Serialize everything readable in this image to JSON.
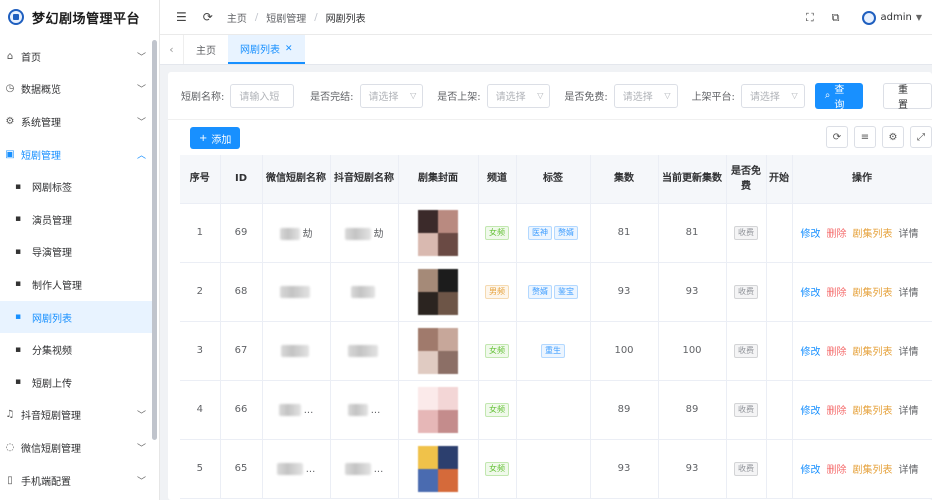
{
  "brand": {
    "title": "梦幻剧场管理平台"
  },
  "sidebar": {
    "items": [
      {
        "label": "首页",
        "icon": "home-icon"
      },
      {
        "label": "数据概览",
        "icon": "dashboard-icon"
      },
      {
        "label": "系统管理",
        "icon": "gear-icon"
      },
      {
        "label": "短剧管理",
        "icon": "video-icon",
        "open": true
      },
      {
        "label": "网剧标签",
        "sub": true
      },
      {
        "label": "演员管理",
        "sub": true
      },
      {
        "label": "导演管理",
        "sub": true
      },
      {
        "label": "制作人管理",
        "sub": true
      },
      {
        "label": "网剧列表",
        "sub": true,
        "active": true
      },
      {
        "label": "分集视频",
        "sub": true
      },
      {
        "label": "短剧上传",
        "sub": true
      },
      {
        "label": "抖音短剧管理",
        "icon": "music-icon"
      },
      {
        "label": "微信短剧管理",
        "icon": "chat-icon"
      },
      {
        "label": "手机端配置",
        "icon": "phone-icon"
      }
    ]
  },
  "header": {
    "breadcrumb": [
      "主页",
      "短剧管理",
      "网剧列表"
    ],
    "user": "admin"
  },
  "tabs": [
    {
      "label": "主页"
    },
    {
      "label": "网剧列表",
      "active": true
    }
  ],
  "filters": {
    "name_label": "短剧名称:",
    "name_placeholder": "请输入短",
    "complete_label": "是否完结:",
    "complete_placeholder": "请选择",
    "listed_label": "是否上架:",
    "listed_placeholder": "请选择",
    "free_label": "是否免费:",
    "free_placeholder": "请选择",
    "platform_label": "上架平台:",
    "platform_placeholder": "请选择",
    "search_label": "查询",
    "reset_label": "重置"
  },
  "toolbar": {
    "add_label": "添加"
  },
  "table": {
    "headers": [
      "序号",
      "ID",
      "微信短剧名称",
      "抖音短剧名称",
      "剧集封面",
      "频道",
      "标签",
      "集数",
      "当前更新集数",
      "是否免费",
      "开始",
      "操作"
    ],
    "ops": {
      "edit": "修改",
      "delete": "删除",
      "episodes": "剧集列表",
      "detail": "详情"
    },
    "rows": [
      {
        "no": "1",
        "id": "69",
        "wx": "劫",
        "dy": "劫",
        "channel": "女频",
        "channel_color": "green",
        "tags": [
          "医神",
          "赘婿"
        ],
        "episodes": "81",
        "updated": "81",
        "free": "收费"
      },
      {
        "no": "2",
        "id": "68",
        "wx": "",
        "dy": "",
        "channel": "男频",
        "channel_color": "orange",
        "tags": [
          "赘婿",
          "鉴宝"
        ],
        "episodes": "93",
        "updated": "93",
        "free": "收费"
      },
      {
        "no": "3",
        "id": "67",
        "wx": "",
        "dy": "",
        "channel": "女频",
        "channel_color": "green",
        "tags": [
          "重生"
        ],
        "episodes": "100",
        "updated": "100",
        "free": "收费"
      },
      {
        "no": "4",
        "id": "66",
        "wx": "...",
        "dy": "...",
        "channel": "女频",
        "channel_color": "green",
        "tags": [],
        "episodes": "89",
        "updated": "89",
        "free": "收费"
      },
      {
        "no": "5",
        "id": "65",
        "wx": "...",
        "dy": "...",
        "channel": "女频",
        "channel_color": "green",
        "tags": [],
        "episodes": "93",
        "updated": "93",
        "free": "收费"
      }
    ]
  }
}
